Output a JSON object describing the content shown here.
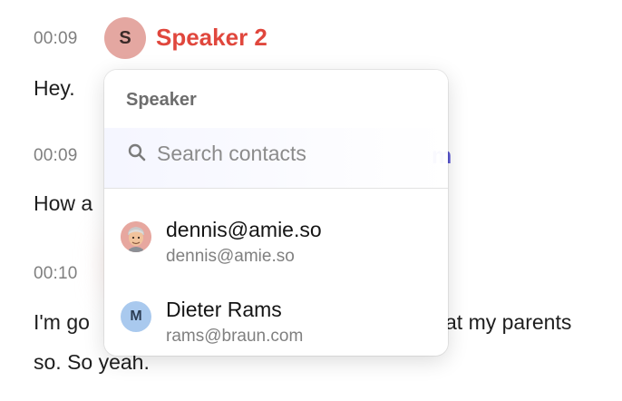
{
  "transcript": {
    "entries": [
      {
        "time": "00:09",
        "speaker_initial": "S",
        "speaker_name": "Speaker 2",
        "text": "Hey."
      },
      {
        "time": "00:09",
        "speaker_name_tail": "m",
        "text": "How a"
      },
      {
        "time": "00:10",
        "text_line1_start": "I'm go",
        "text_line1_end": "at my parents",
        "text_line2": "so. So yeah."
      }
    ],
    "colors": {
      "speaker2": "#e0473d",
      "speaker_other": "#5a57d6"
    }
  },
  "popup": {
    "title": "Speaker",
    "search": {
      "placeholder": "Search contacts",
      "value": "",
      "icon": "search-icon"
    },
    "contacts": [
      {
        "name": "dennis@amie.so",
        "email": "dennis@amie.so",
        "avatar": "memoji-avatar"
      },
      {
        "name": "Dieter Rams",
        "email": "rams@braun.com",
        "avatar_initial": "M",
        "avatar_color": "#a9c9ee"
      }
    ]
  }
}
